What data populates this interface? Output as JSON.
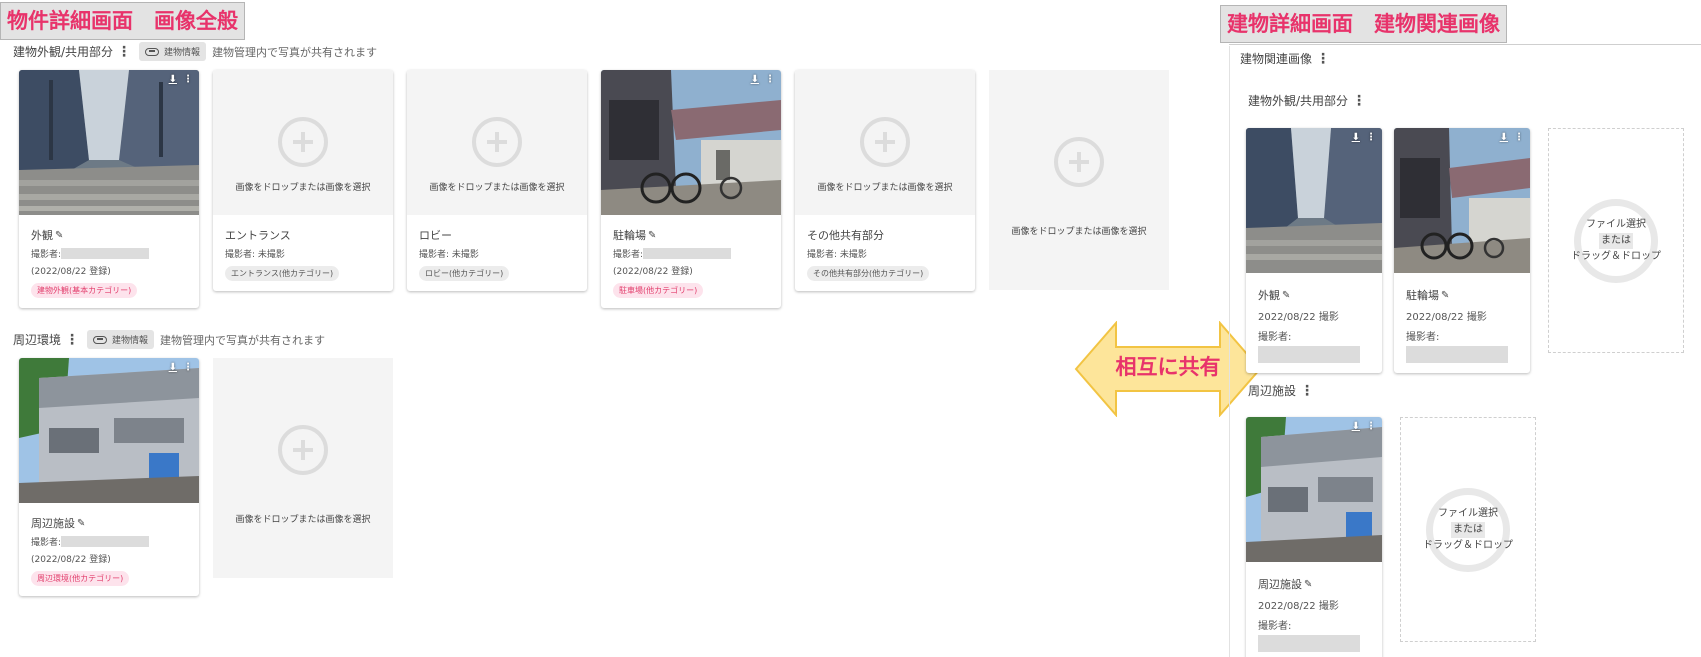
{
  "left_title": "物件詳細画面　画像全般",
  "right_title": "建物詳細画面　建物関連画像",
  "mutual_share_label": "相互に共有",
  "colors": {
    "accent": "#e8336b",
    "arrow_fill": "#fde59a",
    "arrow_stroke": "#f2c443"
  },
  "icons": {
    "kebab": "⋮",
    "pen": "✎",
    "download": "⬇",
    "more": "⋮",
    "link": "link-icon"
  },
  "left": {
    "sections": [
      {
        "name": "建物外観/共用部分",
        "chip": "建物情報",
        "note": "建物管理内で写真が共有されます",
        "cards": [
          {
            "type": "photo",
            "scene": "alley",
            "name": "外観",
            "photographer_label": "撮影者:",
            "date": "(2022/08/22 登録)",
            "badge": "建物外観(基本カテゴリー)",
            "badge_style": "pink"
          },
          {
            "type": "drop",
            "drop_text": "画像をドロップまたは画像を選択",
            "name": "エントランス",
            "photographer": "撮影者: 未撮影",
            "badge": "エントランス(他カテゴリー)",
            "badge_style": "grey"
          },
          {
            "type": "drop",
            "drop_text": "画像をドロップまたは画像を選択",
            "name": "ロビー",
            "photographer": "撮影者: 未撮影",
            "badge": "ロビー(他カテゴリー)",
            "badge_style": "grey"
          },
          {
            "type": "photo",
            "scene": "bikes",
            "name": "駐輪場",
            "photographer_label": "撮影者:",
            "date": "(2022/08/22 登録)",
            "badge": "駐車場(他カテゴリー)",
            "badge_style": "pink"
          },
          {
            "type": "drop",
            "drop_text": "画像をドロップまたは画像を選択",
            "name": "その他共有部分",
            "photographer": "撮影者: 未撮影",
            "badge": "その他共有部分(他カテゴリー)",
            "badge_style": "grey"
          }
        ],
        "extra_drop": "画像をドロップまたは画像を選択"
      },
      {
        "name": "周辺環境",
        "chip": "建物情報",
        "note": "建物管理内で写真が共有されます",
        "cards": [
          {
            "type": "photo",
            "scene": "building",
            "name": "周辺施設",
            "photographer_label": "撮影者:",
            "date": "(2022/08/22 登録)",
            "badge": "周辺環境(他カテゴリー)",
            "badge_style": "pink"
          }
        ],
        "extra_drop": "画像をドロップまたは画像を選択"
      }
    ]
  },
  "right": {
    "panel_title": "建物関連画像",
    "sections": [
      {
        "name": "建物外観/共用部分",
        "cards": [
          {
            "scene": "alley",
            "name": "外観",
            "date": "2022/08/22 撮影",
            "photographer_label": "撮影者:"
          },
          {
            "scene": "bikes",
            "name": "駐輪場",
            "date": "2022/08/22 撮影",
            "photographer_label": "撮影者:"
          }
        ],
        "drop": {
          "line1": "ファイル選択",
          "line2": "または",
          "line3": "ドラッグ＆ドロップ"
        }
      },
      {
        "name": "周辺施設",
        "cards": [
          {
            "scene": "building",
            "name": "周辺施設",
            "date": "2022/08/22 撮影",
            "photographer_label": "撮影者:"
          }
        ],
        "drop": {
          "line1": "ファイル選択",
          "line2": "または",
          "line3": "ドラッグ＆ドロップ"
        }
      }
    ]
  }
}
